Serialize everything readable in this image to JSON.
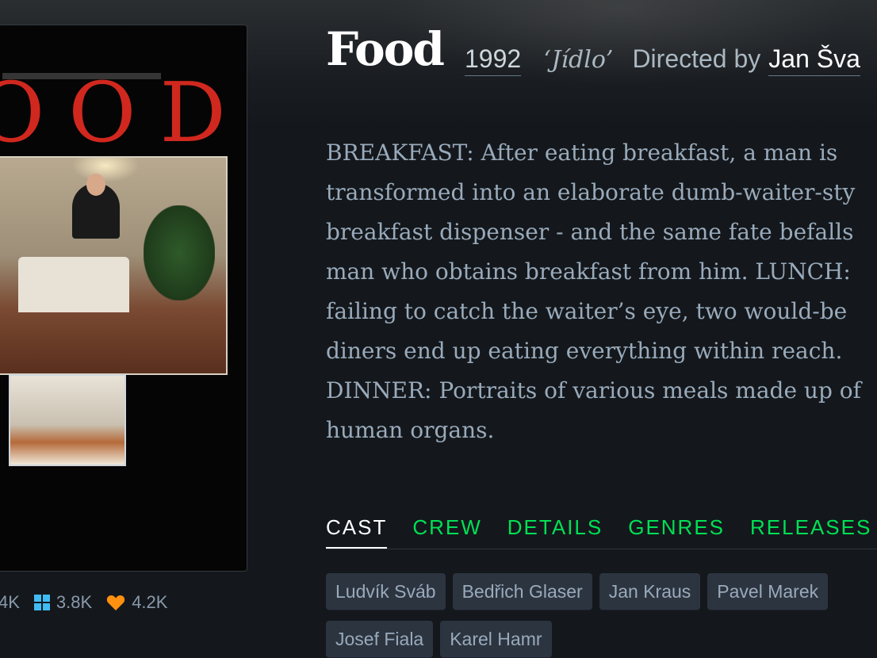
{
  "film": {
    "title": "Food",
    "year": "1992",
    "original_title": "‘Jídlo’",
    "directed_by_label": "Directed by",
    "director": "Jan Šva"
  },
  "poster": {
    "title_text": "OOD"
  },
  "stats": {
    "watched": "4K",
    "lists": "3.8K",
    "likes": "4.2K",
    "watched_icon": "eye-icon",
    "lists_icon": "grid-icon",
    "likes_icon": "heart-icon"
  },
  "synopsis": "BREAKFAST: After eating breakfast, a man is\ntransformed into an elaborate dumb-waiter-sty\nbreakfast dispenser - and the same fate befalls\nman who obtains breakfast from him. LUNCH:\nfailing to catch the waiter’s eye, two would-be\ndiners end up eating everything within reach.\nDINNER: Portraits of various meals made up of\nhuman organs.",
  "tabs": [
    {
      "label": "CAST"
    },
    {
      "label": "CREW"
    },
    {
      "label": "DETAILS"
    },
    {
      "label": "GENRES"
    },
    {
      "label": "RELEASES"
    }
  ],
  "cast": [
    "Ludvík Sváb",
    "Bedřich Glaser",
    "Jan Kraus",
    "Pavel Marek",
    "Josef Fiala",
    "Karel Hamr"
  ],
  "colors": {
    "background": "#14181c",
    "accent_green": "#00e054",
    "heart_orange": "#ff9010",
    "lists_blue": "#40bcf4"
  }
}
